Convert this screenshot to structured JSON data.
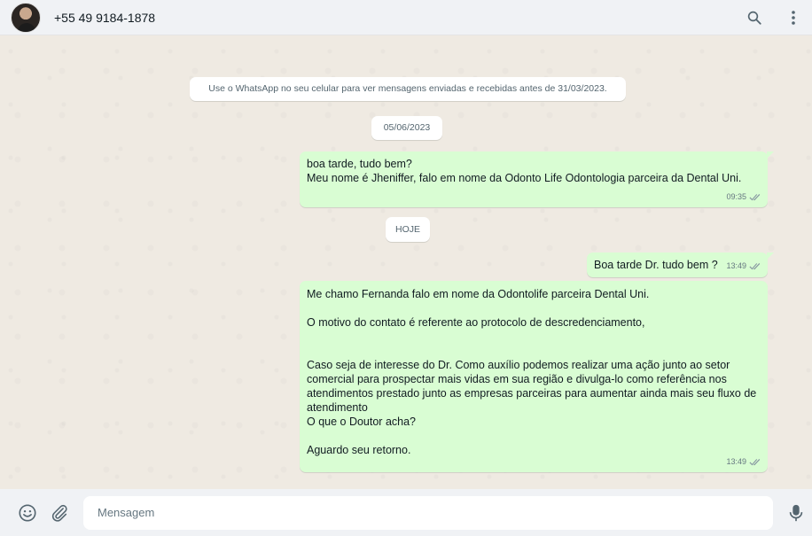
{
  "header": {
    "contact_name": "+55 49 9184-1878",
    "icons": [
      "avatar",
      "search-icon",
      "menu-icon"
    ]
  },
  "chat": {
    "notice": "Use o WhatsApp no seu celular para ver mensagens enviadas e recebidas antes de 31/03/2023.",
    "date_labels": [
      "05/06/2023",
      "HOJE"
    ],
    "messages": [
      {
        "text": "boa tarde,  tudo bem?\nMeu nome é Jheniffer, falo em nome da Odonto Life Odontologia parceira da Dental Uni.",
        "time": "09:35",
        "status": "read"
      },
      {
        "text": "Boa tarde Dr. tudo bem ?",
        "time": "13:49",
        "status": "read"
      },
      {
        "text": "Me chamo Fernanda falo em nome da Odontolife parceira Dental Uni.\n\nO motivo do contato é referente ao protocolo de descredenciamento,\n\n\nCaso seja de interesse do Dr. Como auxílio podemos realizar uma ação junto ao setor comercial para prospectar mais vidas em sua região e divulga-lo como referência nos atendimentos prestado junto as empresas parceiras para aumentar ainda mais seu fluxo de atendimento\nO que o Doutor acha?\n\nAguardo seu retorno.",
        "time": "13:49",
        "status": "read"
      }
    ],
    "colors": {
      "background": "#efeae2",
      "outgoing_bubble": "#d9fdd3",
      "read_ticks": "#8696a0"
    }
  },
  "footer": {
    "input_placeholder": "Mensagem",
    "input_value": "",
    "icons": [
      "emoji-icon",
      "attach-icon",
      "mic-icon"
    ]
  }
}
